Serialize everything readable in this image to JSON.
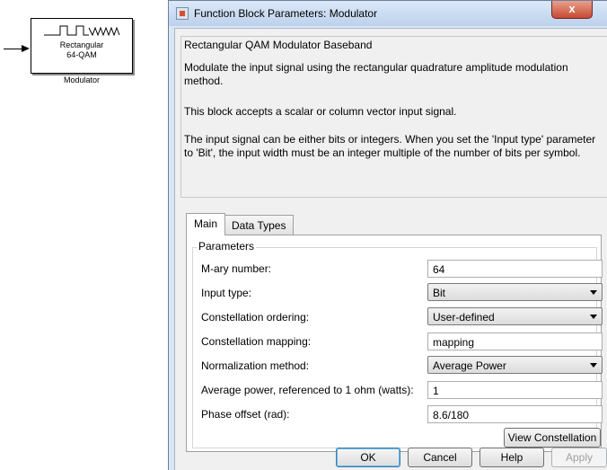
{
  "canvas": {
    "block_line1": "Rectangular",
    "block_line2": "64-QAM",
    "block_name": "Modulator"
  },
  "dialog": {
    "title": "Function Block Parameters: Modulator",
    "close_label": "x",
    "block_type": "Rectangular QAM Modulator Baseband",
    "description_1": "Modulate the input signal using the rectangular quadrature amplitude modulation method.",
    "description_2": "This block accepts a scalar or column vector input signal.",
    "description_3": "The input signal can be either bits or integers. When you set the 'Input type' parameter to 'Bit', the input width must be an integer multiple of the number of bits per symbol.",
    "tabs": [
      {
        "label": "Main",
        "active": true
      },
      {
        "label": "Data Types",
        "active": false
      }
    ],
    "params_title": "Parameters",
    "params": {
      "mary_label": "M-ary number:",
      "mary_value": "64",
      "input_type_label": "Input type:",
      "input_type_value": "Bit",
      "ordering_label": "Constellation ordering:",
      "ordering_value": "User-defined",
      "mapping_label": "Constellation mapping:",
      "mapping_value": "mapping",
      "norm_label": "Normalization method:",
      "norm_value": "Average Power",
      "avg_power_label": "Average power, referenced to 1 ohm (watts):",
      "avg_power_value": "1",
      "phase_label": "Phase offset (rad):",
      "phase_value": "8.6/180"
    },
    "view_constellation_label": "View Constellation",
    "buttons": {
      "ok": "OK",
      "cancel": "Cancel",
      "help": "Help",
      "apply": "Apply"
    }
  }
}
